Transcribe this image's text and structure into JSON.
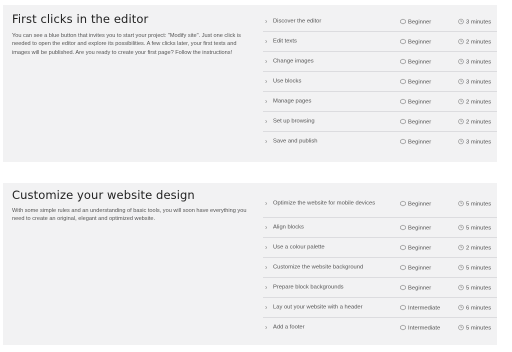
{
  "sections": [
    {
      "title": "First clicks in the editor",
      "description": "You can see a blue button that invites you to start your project: \"Modify site\". Just one click is needed to open the editor and explore its possibilities. A few clicks later, your first texts and images will be published. Are you ready to create your first page? Follow the instructions!",
      "lessons": [
        {
          "name": "Discover the editor",
          "level": "Beginner",
          "duration": "3 minutes"
        },
        {
          "name": "Edit texts",
          "level": "Beginner",
          "duration": "2 minutes"
        },
        {
          "name": "Change images",
          "level": "Beginner",
          "duration": "3 minutes"
        },
        {
          "name": "Use blocks",
          "level": "Beginner",
          "duration": "3 minutes"
        },
        {
          "name": "Manage pages",
          "level": "Beginner",
          "duration": "2 minutes"
        },
        {
          "name": "Set up browsing",
          "level": "Beginner",
          "duration": "2 minutes"
        },
        {
          "name": "Save and publish",
          "level": "Beginner",
          "duration": "3 minutes"
        }
      ]
    },
    {
      "title": "Customize your website design",
      "description": "With some simple rules and an understanding of basic tools, you will soon have everything you need to create an original, elegant and optimized website.",
      "lessons": [
        {
          "name": "Optimize the website for mobile devices",
          "level": "Beginner",
          "duration": "5 minutes"
        },
        {
          "name": "Align blocks",
          "level": "Beginner",
          "duration": "5 minutes"
        },
        {
          "name": "Use a colour palette",
          "level": "Beginner",
          "duration": "2 minutes"
        },
        {
          "name": "Customize the website background",
          "level": "Beginner",
          "duration": "5 minutes"
        },
        {
          "name": "Prepare block backgrounds",
          "level": "Beginner",
          "duration": "5 minutes"
        },
        {
          "name": "Lay out your website with a header",
          "level": "Intermediate",
          "duration": "6 minutes"
        },
        {
          "name": "Add a footer",
          "level": "Intermediate",
          "duration": "5 minutes"
        }
      ]
    }
  ],
  "icons": {
    "row_expand": "chevron-right-icon",
    "level": "level-badge-icon",
    "duration": "clock-icon"
  }
}
